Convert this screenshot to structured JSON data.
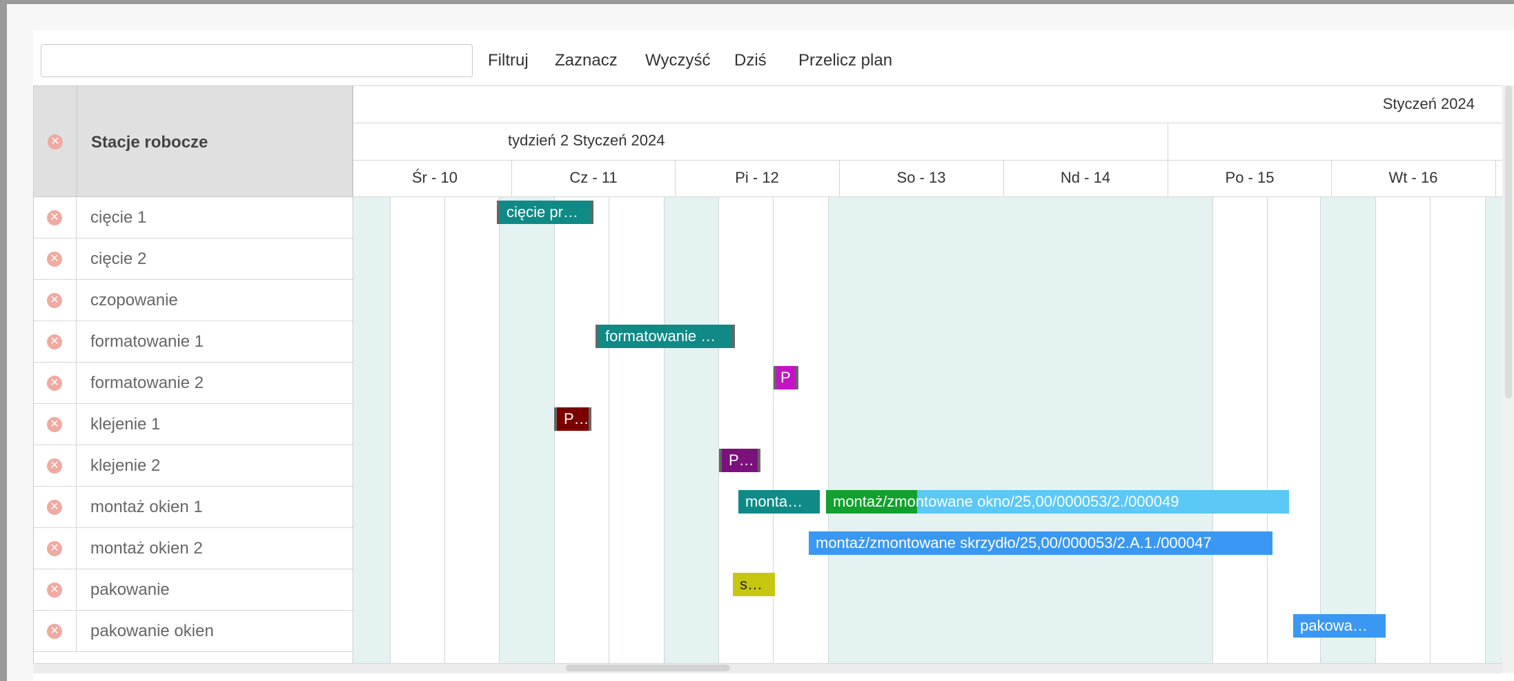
{
  "toolbar": {
    "search_value": "",
    "search_placeholder": "",
    "buttons": [
      "Filtruj",
      "Zaznacz",
      "Wyczyść",
      "Dziś",
      "Przelicz plan"
    ]
  },
  "grid": {
    "header_title": "Stacje robocze",
    "rows": [
      "cięcie 1",
      "cięcie 2",
      "czopowanie",
      "formatowanie 1",
      "formatowanie 2",
      "klejenie 1",
      "klejenie 2",
      "montaż okien 1",
      "montaż okien 2",
      "pakowanie",
      "pakowanie okien"
    ]
  },
  "timeline": {
    "month": "Styczeń 2024",
    "week": "tydzień 2 Styczeń 2024",
    "days": [
      "Śr - 10",
      "Cz - 11",
      "Pi - 12",
      "So - 13",
      "Nd - 14",
      "Po - 15",
      "Wt - 16"
    ]
  },
  "tasks": [
    {
      "label": "cięcie pr…",
      "color": "#0f8a86"
    },
    {
      "label": "formatowanie …",
      "color": "#0f8a86"
    },
    {
      "label": "P",
      "color": "#c413c4"
    },
    {
      "label": "P…",
      "color": "#7a0000"
    },
    {
      "label": "P…",
      "color": "#7b117b"
    },
    {
      "label": "monta…",
      "color": "#0f8a86"
    },
    {
      "label": "montaż/zmontowane okno/25,00/000053/2./000049",
      "color": "#5bc8f5",
      "progress_color": "#12a02e"
    },
    {
      "label": "montaż/zmontowane skrzydło/25,00/000053/2.A.1./000047",
      "color": "#3a98f2"
    },
    {
      "label": "s…",
      "color": "#c7c712"
    },
    {
      "label": "pakowa…",
      "color": "#3a98f2"
    }
  ],
  "colors": {
    "weekend_shade": "#e4f2f2",
    "remove_icon": "#f1a9a0"
  }
}
